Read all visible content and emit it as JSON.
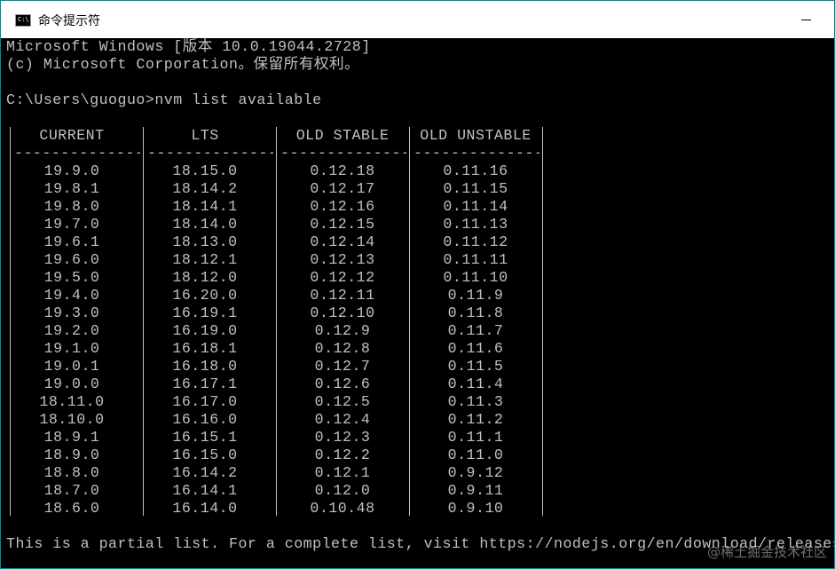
{
  "window": {
    "title": "命令提示符",
    "icon": "cmd-icon",
    "icon_glyph": "C:\\",
    "minimize": "minimize-icon"
  },
  "console": {
    "lines": [
      "Microsoft Windows [版本 10.0.19044.2728]",
      "(c) Microsoft Corporation。保留所有权利。",
      "",
      "C:\\Users\\guoguo>nvm list available"
    ],
    "table": {
      "headers": [
        "CURRENT",
        "LTS",
        "OLD STABLE",
        "OLD UNSTABLE"
      ],
      "separator": "--------------",
      "rows": [
        [
          "19.9.0",
          "18.15.0",
          "0.12.18",
          "0.11.16"
        ],
        [
          "19.8.1",
          "18.14.2",
          "0.12.17",
          "0.11.15"
        ],
        [
          "19.8.0",
          "18.14.1",
          "0.12.16",
          "0.11.14"
        ],
        [
          "19.7.0",
          "18.14.0",
          "0.12.15",
          "0.11.13"
        ],
        [
          "19.6.1",
          "18.13.0",
          "0.12.14",
          "0.11.12"
        ],
        [
          "19.6.0",
          "18.12.1",
          "0.12.13",
          "0.11.11"
        ],
        [
          "19.5.0",
          "18.12.0",
          "0.12.12",
          "0.11.10"
        ],
        [
          "19.4.0",
          "16.20.0",
          "0.12.11",
          "0.11.9"
        ],
        [
          "19.3.0",
          "16.19.1",
          "0.12.10",
          "0.11.8"
        ],
        [
          "19.2.0",
          "16.19.0",
          "0.12.9",
          "0.11.7"
        ],
        [
          "19.1.0",
          "16.18.1",
          "0.12.8",
          "0.11.6"
        ],
        [
          "19.0.1",
          "16.18.0",
          "0.12.7",
          "0.11.5"
        ],
        [
          "19.0.0",
          "16.17.1",
          "0.12.6",
          "0.11.4"
        ],
        [
          "18.11.0",
          "16.17.0",
          "0.12.5",
          "0.11.3"
        ],
        [
          "18.10.0",
          "16.16.0",
          "0.12.4",
          "0.11.2"
        ],
        [
          "18.9.1",
          "16.15.1",
          "0.12.3",
          "0.11.1"
        ],
        [
          "18.9.0",
          "16.15.0",
          "0.12.2",
          "0.11.0"
        ],
        [
          "18.8.0",
          "16.14.2",
          "0.12.1",
          "0.9.12"
        ],
        [
          "18.7.0",
          "16.14.1",
          "0.12.0",
          "0.9.11"
        ],
        [
          "18.6.0",
          "16.14.0",
          "0.10.48",
          "0.9.10"
        ]
      ]
    },
    "footer": "This is a partial list. For a complete list, visit https://nodejs.org/en/download/releases"
  },
  "watermark": "@稀土掘金技术社区",
  "colors": {
    "console_bg": "#000000",
    "console_fg": "#c0c0c0",
    "titlebar_bg": "#ffffff",
    "desktop": "#2aa4a0"
  }
}
